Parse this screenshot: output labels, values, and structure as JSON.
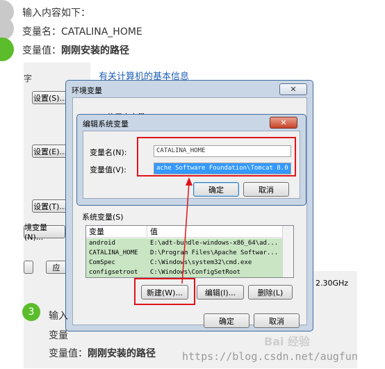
{
  "steps": [
    {
      "number": "",
      "text": "输入内容如下：",
      "color": "#c9c9c9"
    },
    {
      "number": "",
      "label": "变量名：",
      "value": "CATALINA_HOME",
      "color": "#c9c9c9"
    },
    {
      "number": "",
      "label": "变量值：",
      "value": "刚刚安装的路径",
      "color": "#5bbd2b"
    }
  ],
  "background_window": {
    "heading": "有关计算机的基本信息",
    "buttons": [
      "设置(S)...",
      "设置(E)...",
      "设置(T)...",
      "境变量(N)...",
      "应"
    ],
    "left_fragment": "字",
    "cpu_text": "2.30GHz"
  },
  "env_window": {
    "title": "环境变量",
    "user_vars_fragment": "的用户变量(U)",
    "system_vars_label": "系统变量(S)",
    "columns": [
      "变量",
      "值"
    ],
    "rows": [
      {
        "name": "android",
        "value": "E:\\adt-bundle-windows-x86_64\\ad..."
      },
      {
        "name": "CATALINA_HOME",
        "value": "D:\\Program Files\\Apache Softwar..."
      },
      {
        "name": "ComSpec",
        "value": "C:\\Windows\\system32\\cmd.exe"
      },
      {
        "name": "configsetroot",
        "value": "C:\\Windows\\ConfigSetRoot"
      }
    ],
    "new_button": "新建(W)...",
    "edit_button": "编辑(I)...",
    "delete_button": "删除(L)",
    "ok_button": "确定",
    "cancel_button": "取消"
  },
  "edit_dialog": {
    "title": "编辑系统变量",
    "name_label": "变量名(N):",
    "name_value": "CATALINA_HOME",
    "value_label": "变量值(V):",
    "value_value": "ache Software Foundation\\Tomcat 8.0",
    "ok_button": "确定",
    "cancel_button": "取消",
    "close_glyph": "✕"
  },
  "bottom_step": {
    "number": "3",
    "line1": "输入",
    "line2": "变量",
    "label": "变量值：",
    "value": "刚刚安装的路径",
    "color": "#5bbd2b"
  },
  "watermark": "https://blog.csdn.net/augfun",
  "baidu_mark": "Bai 经验",
  "colors": {
    "highlight": "#e0121b",
    "arrow": "#e0121b",
    "selection": "#3399ff"
  }
}
